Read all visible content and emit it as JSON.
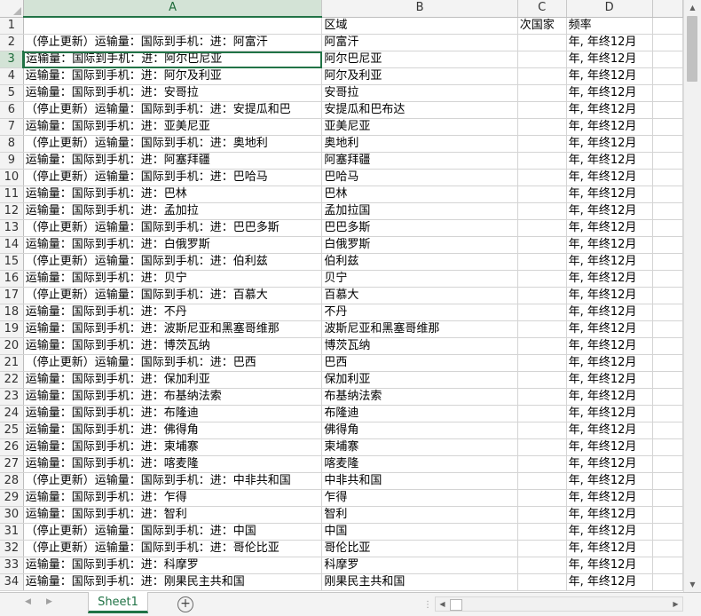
{
  "columns": [
    "A",
    "B",
    "C",
    "D",
    ""
  ],
  "selected_column": "A",
  "active_row": 3,
  "rows": [
    {
      "num": "1",
      "a": "",
      "b": "区域",
      "c": "次国家",
      "d": "频率"
    },
    {
      "num": "2",
      "a": "（停止更新）运输量：国际到手机：进：阿富汗",
      "b": "阿富汗",
      "c": "",
      "d": "年, 年终12月"
    },
    {
      "num": "3",
      "a": "运输量：国际到手机：进：阿尔巴尼亚",
      "b": "阿尔巴尼亚",
      "c": "",
      "d": "年, 年终12月"
    },
    {
      "num": "4",
      "a": "运输量：国际到手机：进：阿尔及利亚",
      "b": "阿尔及利亚",
      "c": "",
      "d": "年, 年终12月"
    },
    {
      "num": "5",
      "a": "运输量：国际到手机：进：安哥拉",
      "b": "安哥拉",
      "c": "",
      "d": "年, 年终12月"
    },
    {
      "num": "6",
      "a": "（停止更新）运输量：国际到手机：进：安提瓜和巴",
      "b": "安提瓜和巴布达",
      "c": "",
      "d": "年, 年终12月"
    },
    {
      "num": "7",
      "a": "运输量：国际到手机：进：亚美尼亚",
      "b": "亚美尼亚",
      "c": "",
      "d": "年, 年终12月"
    },
    {
      "num": "8",
      "a": "（停止更新）运输量：国际到手机：进：奥地利",
      "b": "奥地利",
      "c": "",
      "d": "年, 年终12月"
    },
    {
      "num": "9",
      "a": "运输量：国际到手机：进：阿塞拜疆",
      "b": "阿塞拜疆",
      "c": "",
      "d": "年, 年终12月"
    },
    {
      "num": "10",
      "a": "（停止更新）运输量：国际到手机：进：巴哈马",
      "b": "巴哈马",
      "c": "",
      "d": "年, 年终12月"
    },
    {
      "num": "11",
      "a": "运输量：国际到手机：进：巴林",
      "b": "巴林",
      "c": "",
      "d": "年, 年终12月"
    },
    {
      "num": "12",
      "a": "运输量：国际到手机：进：孟加拉",
      "b": "孟加拉国",
      "c": "",
      "d": "年, 年终12月"
    },
    {
      "num": "13",
      "a": "（停止更新）运输量：国际到手机：进：巴巴多斯",
      "b": "巴巴多斯",
      "c": "",
      "d": "年, 年终12月"
    },
    {
      "num": "14",
      "a": "运输量：国际到手机：进：白俄罗斯",
      "b": "白俄罗斯",
      "c": "",
      "d": "年, 年终12月"
    },
    {
      "num": "15",
      "a": "（停止更新）运输量：国际到手机：进：伯利兹",
      "b": "伯利兹",
      "c": "",
      "d": "年, 年终12月"
    },
    {
      "num": "16",
      "a": "运输量：国际到手机：进：贝宁",
      "b": "贝宁",
      "c": "",
      "d": "年, 年终12月"
    },
    {
      "num": "17",
      "a": "（停止更新）运输量：国际到手机：进：百慕大",
      "b": "百慕大",
      "c": "",
      "d": "年, 年终12月"
    },
    {
      "num": "18",
      "a": "运输量：国际到手机：进：不丹",
      "b": "不丹",
      "c": "",
      "d": "年, 年终12月"
    },
    {
      "num": "19",
      "a": "运输量：国际到手机：进：波斯尼亚和黑塞哥维那",
      "b": "波斯尼亚和黑塞哥维那",
      "c": "",
      "d": "年, 年终12月"
    },
    {
      "num": "20",
      "a": "运输量：国际到手机：进：博茨瓦纳",
      "b": "博茨瓦纳",
      "c": "",
      "d": "年, 年终12月"
    },
    {
      "num": "21",
      "a": "（停止更新）运输量：国际到手机：进：巴西",
      "b": "巴西",
      "c": "",
      "d": "年, 年终12月"
    },
    {
      "num": "22",
      "a": "运输量：国际到手机：进：保加利亚",
      "b": "保加利亚",
      "c": "",
      "d": "年, 年终12月"
    },
    {
      "num": "23",
      "a": "运输量：国际到手机：进：布基纳法索",
      "b": "布基纳法索",
      "c": "",
      "d": "年, 年终12月"
    },
    {
      "num": "24",
      "a": "运输量：国际到手机：进：布隆迪",
      "b": "布隆迪",
      "c": "",
      "d": "年, 年终12月"
    },
    {
      "num": "25",
      "a": "运输量：国际到手机：进：佛得角",
      "b": "佛得角",
      "c": "",
      "d": "年, 年终12月"
    },
    {
      "num": "26",
      "a": "运输量：国际到手机：进：柬埔寨",
      "b": "柬埔寨",
      "c": "",
      "d": "年, 年终12月"
    },
    {
      "num": "27",
      "a": "运输量：国际到手机：进：喀麦隆",
      "b": "喀麦隆",
      "c": "",
      "d": "年, 年终12月"
    },
    {
      "num": "28",
      "a": "（停止更新）运输量：国际到手机：进：中非共和国",
      "b": "中非共和国",
      "c": "",
      "d": "年, 年终12月"
    },
    {
      "num": "29",
      "a": "运输量：国际到手机：进：乍得",
      "b": "乍得",
      "c": "",
      "d": "年, 年终12月"
    },
    {
      "num": "30",
      "a": "运输量：国际到手机：进：智利",
      "b": "智利",
      "c": "",
      "d": "年, 年终12月"
    },
    {
      "num": "31",
      "a": "（停止更新）运输量：国际到手机：进：中国",
      "b": "中国",
      "c": "",
      "d": "年, 年终12月"
    },
    {
      "num": "32",
      "a": "（停止更新）运输量：国际到手机：进：哥伦比亚",
      "b": "哥伦比亚",
      "c": "",
      "d": "年, 年终12月"
    },
    {
      "num": "33",
      "a": "运输量：国际到手机：进：科摩罗",
      "b": "科摩罗",
      "c": "",
      "d": "年, 年终12月"
    },
    {
      "num": "34",
      "a": "运输量：国际到手机：进：刚果民主共和国",
      "b": "刚果民主共和国",
      "c": "",
      "d": "年, 年终12月"
    }
  ],
  "sheet_tab": "Sheet1",
  "icons": {
    "add_sheet": "+",
    "scroll_up": "▲",
    "scroll_down": "▼",
    "scroll_left": "◀",
    "scroll_right": "▶",
    "tab_prev": "◀",
    "tab_next": "▶",
    "separator": "⋮"
  },
  "colors": {
    "accent": "#217346",
    "header_bg": "#f3f3f3",
    "selected_header_bg": "#d3e3d6"
  }
}
